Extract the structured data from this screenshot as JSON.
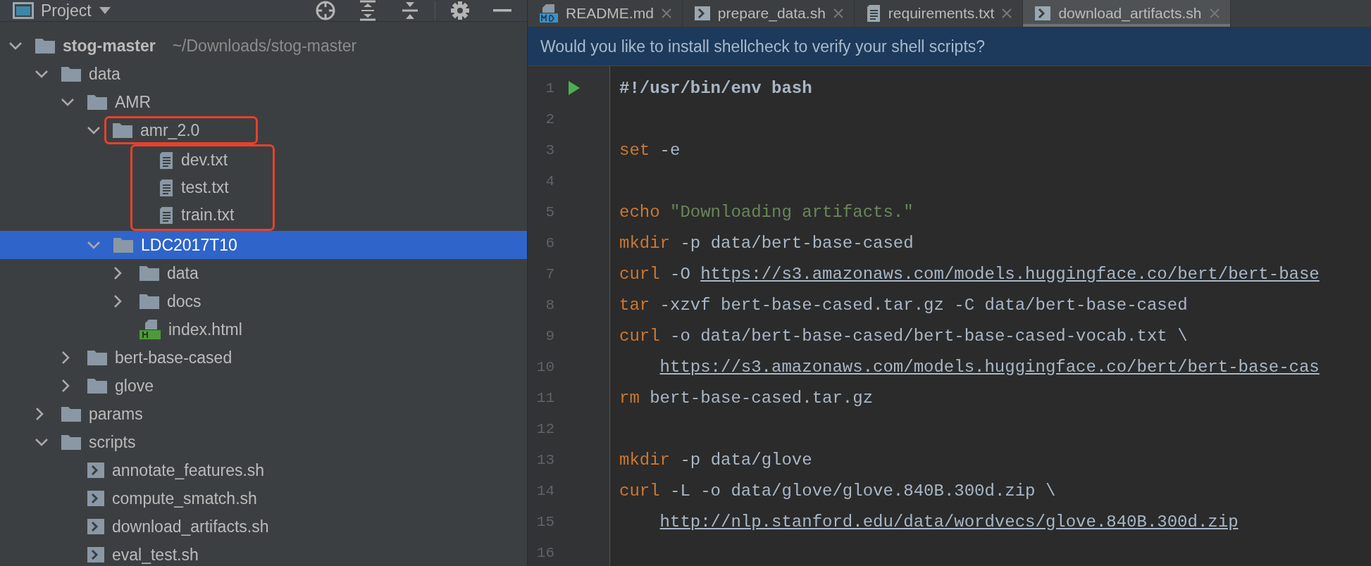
{
  "project_panel": {
    "title": "Project"
  },
  "tree": [
    {
      "name": "stog-master",
      "path": "~/Downloads/stog-master",
      "kind": "folder",
      "expanded": true,
      "selected": false,
      "children": [
        {
          "name": "data",
          "kind": "folder",
          "expanded": true,
          "selected": false,
          "children": [
            {
              "name": "AMR",
              "kind": "folder",
              "expanded": true,
              "selected": false,
              "children": [
                {
                  "name": "amr_2.0",
                  "kind": "folder",
                  "expanded": true,
                  "selected": false,
                  "marked": true,
                  "children_marked": true,
                  "children": [
                    {
                      "name": "dev.txt",
                      "kind": "text",
                      "selected": false
                    },
                    {
                      "name": "test.txt",
                      "kind": "text",
                      "selected": false
                    },
                    {
                      "name": "train.txt",
                      "kind": "text",
                      "selected": false
                    }
                  ]
                },
                {
                  "name": "LDC2017T10",
                  "kind": "folder",
                  "expanded": true,
                  "selected": true,
                  "children": [
                    {
                      "name": "data",
                      "kind": "folder",
                      "expanded": false,
                      "selected": false
                    },
                    {
                      "name": "docs",
                      "kind": "folder",
                      "expanded": false,
                      "selected": false
                    },
                    {
                      "name": "index.html",
                      "kind": "html",
                      "selected": false
                    }
                  ]
                }
              ]
            },
            {
              "name": "bert-base-cased",
              "kind": "folder",
              "expanded": false,
              "selected": false
            },
            {
              "name": "glove",
              "kind": "folder",
              "expanded": false,
              "selected": false
            }
          ]
        },
        {
          "name": "params",
          "kind": "folder",
          "expanded": false,
          "selected": false
        },
        {
          "name": "scripts",
          "kind": "folder",
          "expanded": true,
          "selected": false,
          "children": [
            {
              "name": "annotate_features.sh",
              "kind": "shell",
              "selected": false
            },
            {
              "name": "compute_smatch.sh",
              "kind": "shell",
              "selected": false
            },
            {
              "name": "download_artifacts.sh",
              "kind": "shell",
              "selected": false
            },
            {
              "name": "eval_test.sh",
              "kind": "shell",
              "selected": false
            }
          ]
        }
      ]
    }
  ],
  "tabs": [
    {
      "label": "README.md",
      "kind": "markdown",
      "selected": false
    },
    {
      "label": "prepare_data.sh",
      "kind": "shell",
      "selected": false
    },
    {
      "label": "requirements.txt",
      "kind": "text",
      "selected": false
    },
    {
      "label": "download_artifacts.sh",
      "kind": "shell",
      "selected": true
    }
  ],
  "banner": {
    "text": "Would you like to install shellcheck to verify your shell scripts?"
  },
  "code_lines": [
    {
      "number": "1",
      "run": true,
      "tokens": [
        {
          "kind": "shebang",
          "text": "#!/usr/bin/env bash"
        }
      ]
    },
    {
      "number": "2"
    },
    {
      "number": "3",
      "tokens": [
        {
          "kind": "keyword",
          "text": "set"
        },
        {
          "kind": "plain",
          "text": " -e"
        }
      ]
    },
    {
      "number": "4"
    },
    {
      "number": "5",
      "tokens": [
        {
          "kind": "keyword",
          "text": "echo"
        },
        {
          "kind": "string",
          "text": "\"Downloading artifacts.\""
        }
      ]
    },
    {
      "number": "6",
      "tokens": [
        {
          "kind": "keyword",
          "text": "mkdir"
        },
        {
          "kind": "plain",
          "text": " -p data/bert-base-cased"
        }
      ]
    },
    {
      "number": "7",
      "tokens": [
        {
          "kind": "keyword",
          "text": "curl"
        },
        {
          "kind": "plain",
          "text": " -O "
        },
        {
          "kind": "link",
          "text": "https://s3.amazonaws.com/models.huggingface.co/bert/bert-base"
        }
      ]
    },
    {
      "number": "8",
      "tokens": [
        {
          "kind": "keyword",
          "text": "tar"
        },
        {
          "kind": "plain",
          "text": " -xzvf bert-base-cased.tar.gz -C data/bert-base-cased"
        }
      ]
    },
    {
      "number": "9",
      "tokens": [
        {
          "kind": "keyword",
          "text": "curl"
        },
        {
          "kind": "plain",
          "text": " -o data/bert-base-cased/bert-base-cased-vocab.txt \\"
        }
      ]
    },
    {
      "number": "10",
      "continuation": true,
      "tokens": [
        {
          "kind": "link",
          "text": "https://s3.amazonaws.com/models.huggingface.co/bert/bert-base-cas"
        }
      ]
    },
    {
      "number": "11",
      "tokens": [
        {
          "kind": "keyword",
          "text": "rm"
        },
        {
          "kind": "plain",
          "text": " bert-base-cased.tar.gz"
        }
      ]
    },
    {
      "number": "12"
    },
    {
      "number": "13",
      "tokens": [
        {
          "kind": "keyword",
          "text": "mkdir"
        },
        {
          "kind": "plain",
          "text": " -p data/glove"
        }
      ]
    },
    {
      "number": "14",
      "tokens": [
        {
          "kind": "keyword",
          "text": "curl"
        },
        {
          "kind": "plain",
          "text": " -L -o data/glove/glove.840B.300d.zip \\"
        }
      ]
    },
    {
      "number": "15",
      "continuation": true,
      "tokens": [
        {
          "kind": "link",
          "text": "http://nlp.stanford.edu/data/wordvecs/glove.840B.300d.zip"
        }
      ]
    },
    {
      "number": "16"
    }
  ]
}
